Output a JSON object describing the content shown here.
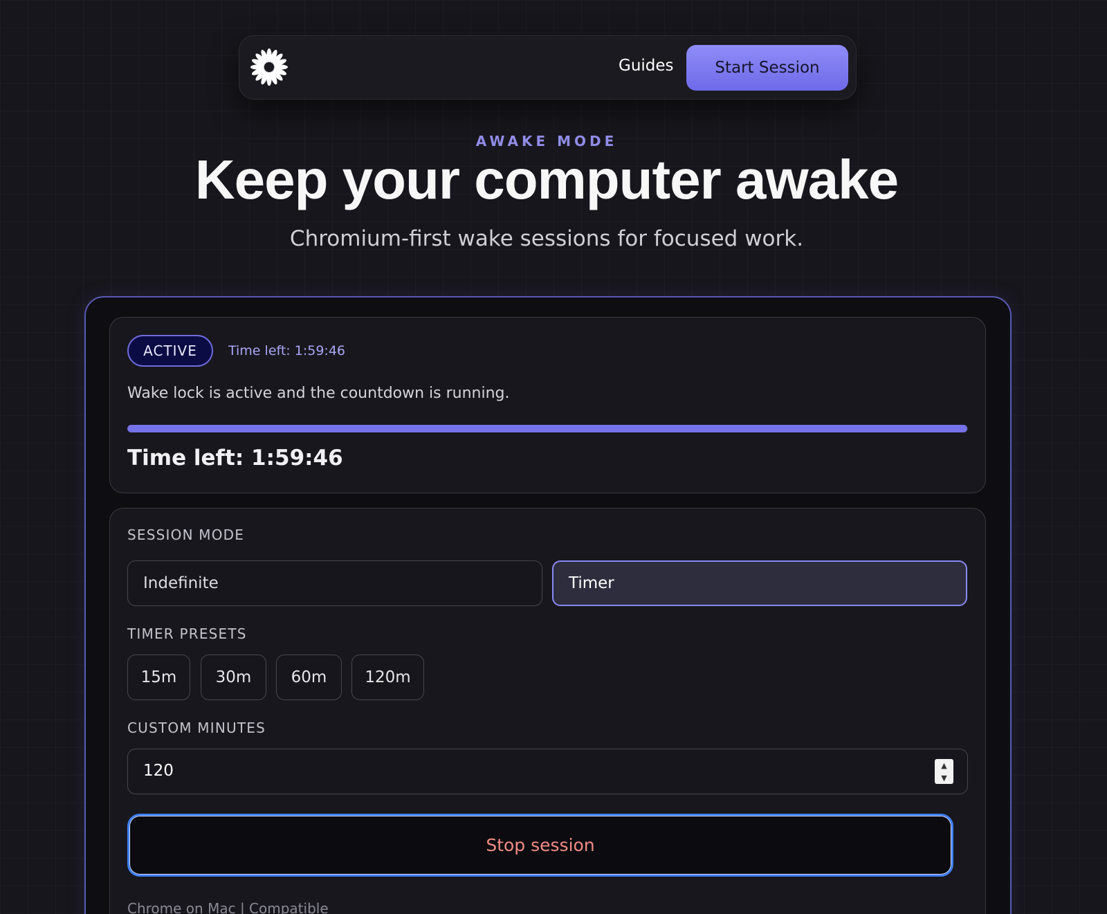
{
  "nav": {
    "logo_icon": "daisy-logo-icon",
    "guides_label": "Guides",
    "start_label": "Start Session"
  },
  "hero": {
    "eyebrow": "AWAKE MODE",
    "title": "Keep your computer awake",
    "subtitle": "Chromium-first wake sessions for focused work."
  },
  "status": {
    "badge": "ACTIVE",
    "time_left_small": "Time left: 1:59:46",
    "message": "Wake lock is active and the countdown is running.",
    "progress_percent": 99.9,
    "time_left_large": "Time left: 1:59:46"
  },
  "settings": {
    "session_mode_label": "SESSION MODE",
    "modes": [
      "Indefinite",
      "Timer"
    ],
    "selected_mode": "Timer",
    "presets_label": "TIMER PRESETS",
    "presets": [
      "15m",
      "30m",
      "60m",
      "120m"
    ],
    "custom_label": "CUSTOM MINUTES",
    "custom_value": "120",
    "stop_label": "Stop session",
    "compat_note": "Chrome on Mac | Compatible"
  },
  "colors": {
    "accent": "#7673ea",
    "background": "#17161c",
    "danger_text": "#f28c86",
    "focus_ring": "#3f80f3"
  }
}
